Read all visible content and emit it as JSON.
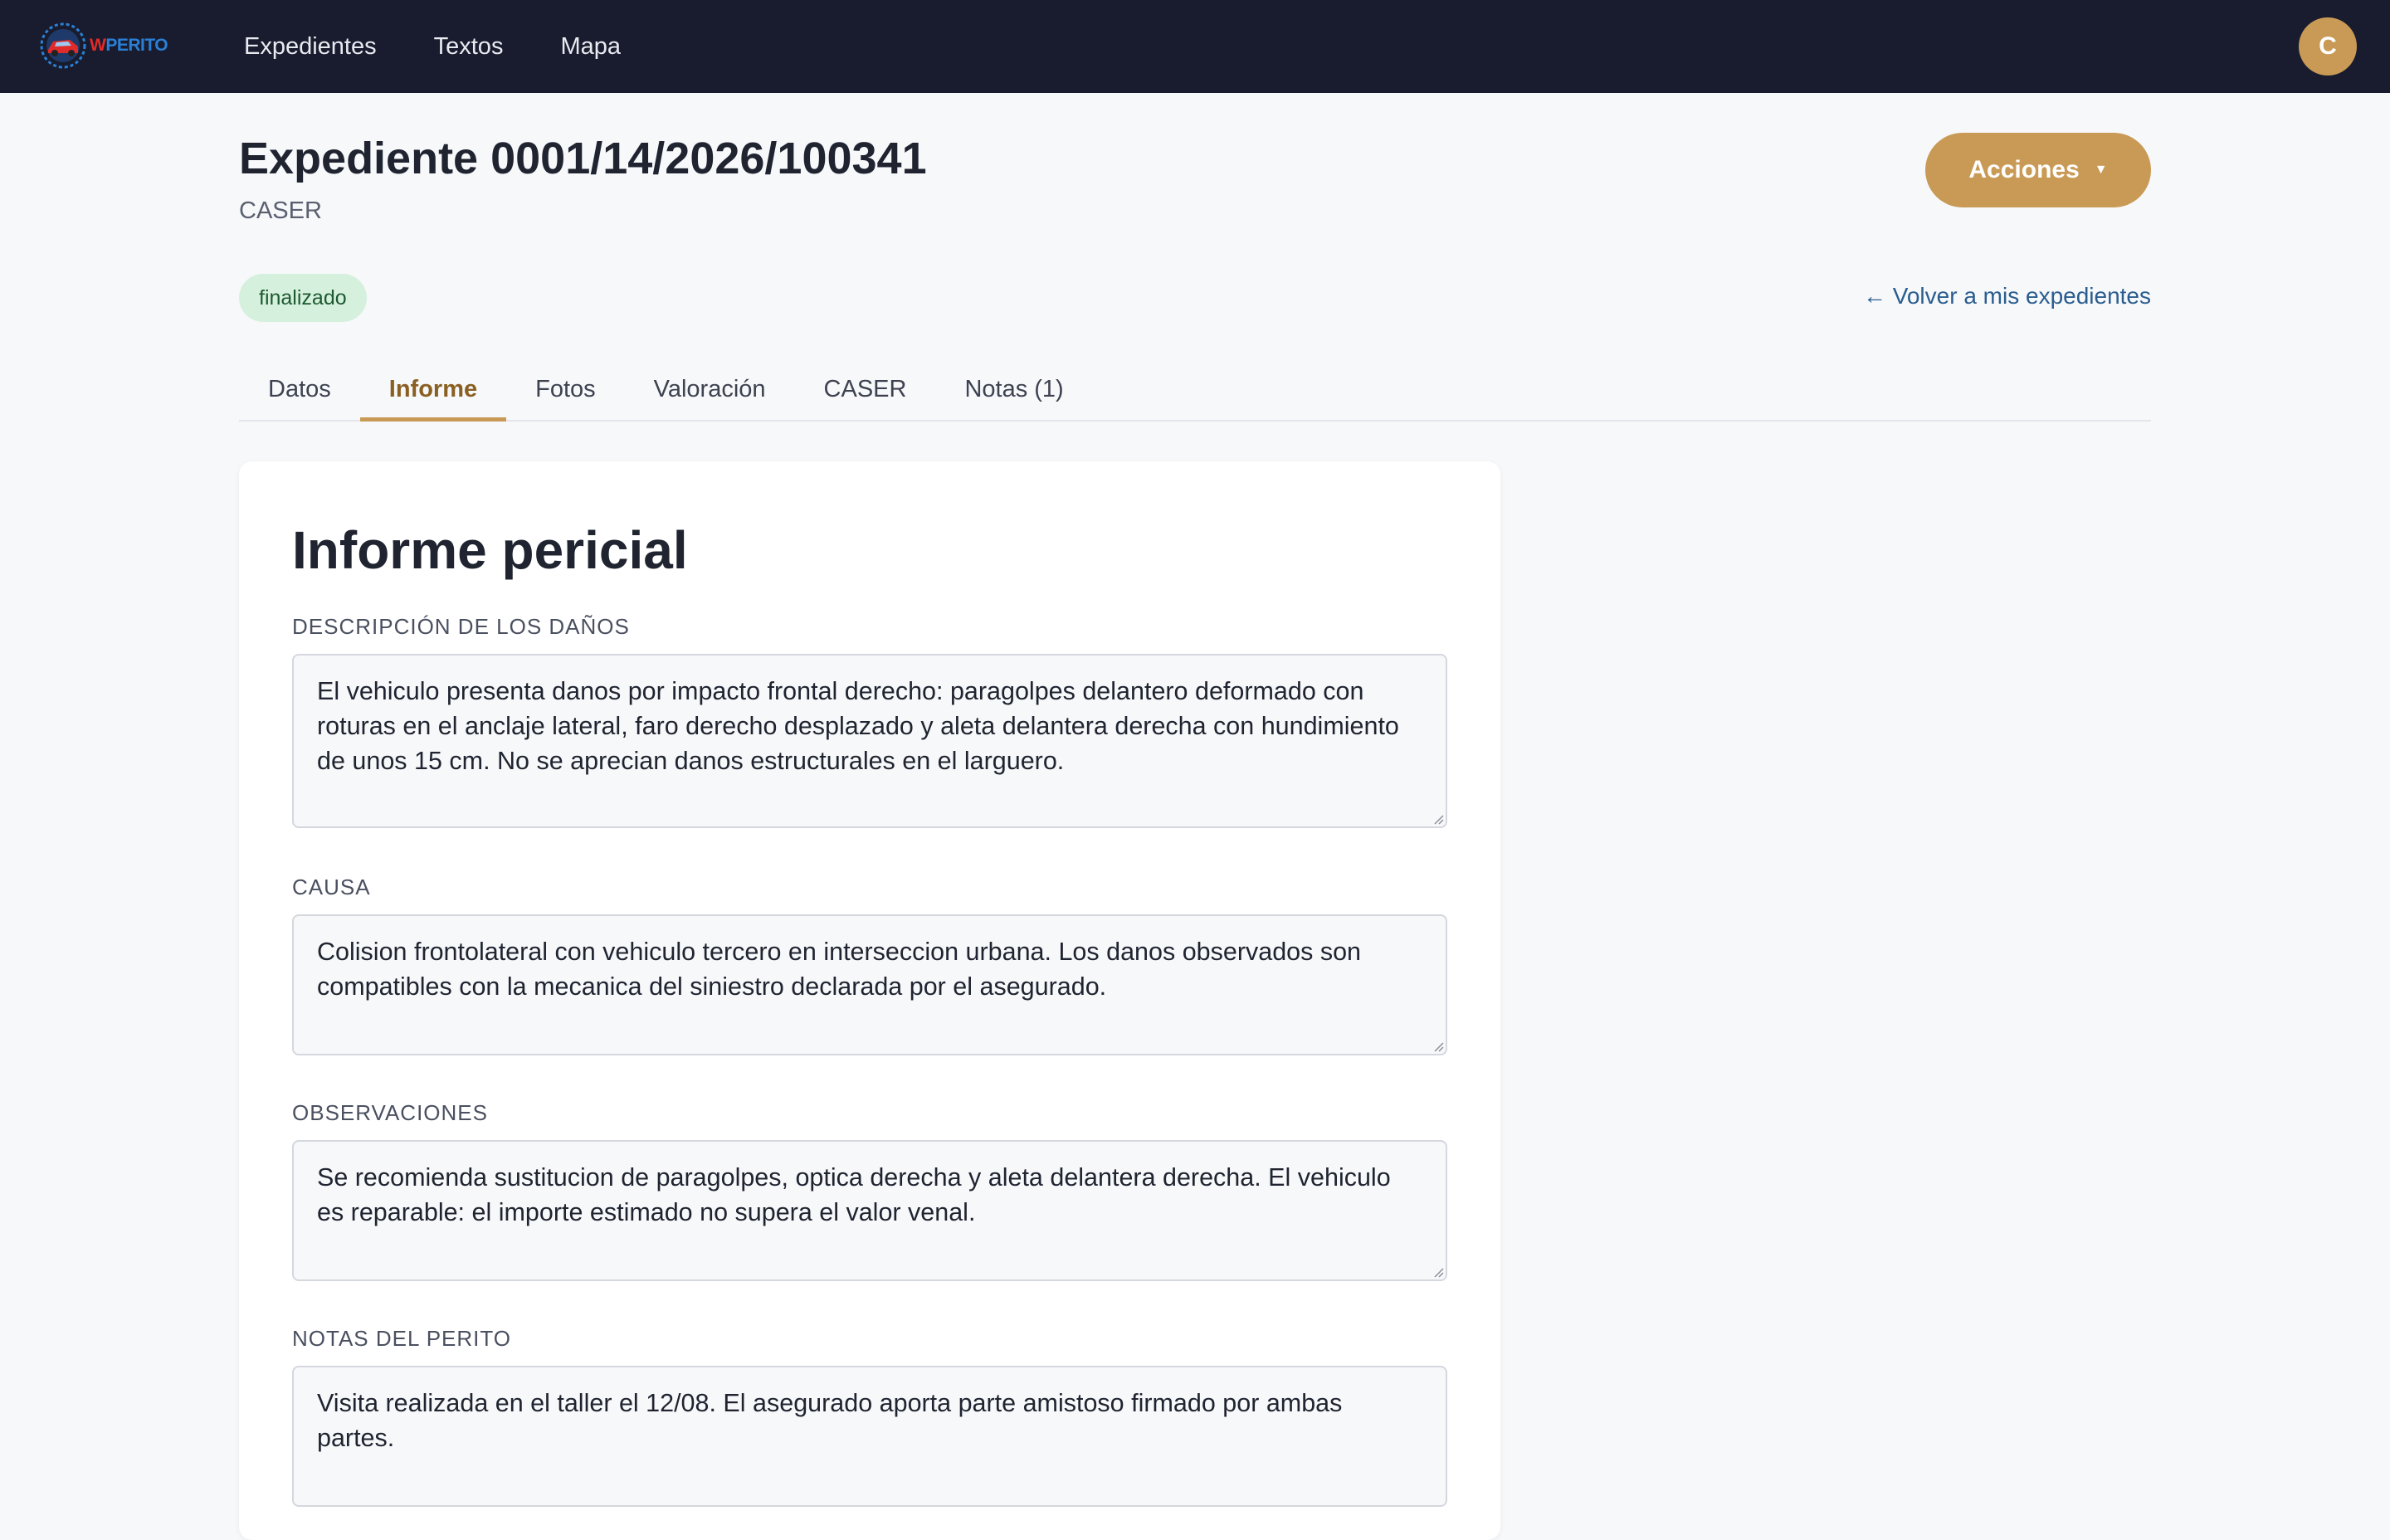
{
  "nav": {
    "logo_w": "W",
    "logo_rest": "PERITO",
    "links": [
      "Expedientes",
      "Textos",
      "Mapa"
    ],
    "avatar_initial": "C"
  },
  "header": {
    "title": "Expediente 0001/14/2026/100341",
    "subtitle": "CASER",
    "actions_label": "Acciones",
    "status": "finalizado",
    "back_link": "← Volver a mis expedientes"
  },
  "tabs": [
    {
      "label": "Datos",
      "active": false
    },
    {
      "label": "Informe",
      "active": true
    },
    {
      "label": "Fotos",
      "active": false
    },
    {
      "label": "Valoración",
      "active": false
    },
    {
      "label": "CASER",
      "active": false
    },
    {
      "label": "Notas (1)",
      "active": false
    }
  ],
  "report": {
    "title": "Informe pericial",
    "fields": [
      {
        "label": "DESCRIPCIÓN DE LOS DAÑOS",
        "value": "El vehiculo presenta danos por impacto frontal derecho: paragolpes delantero deformado con roturas en el anclaje lateral, faro derecho desplazado y aleta delantera derecha con hundimiento de unos 15 cm. No se aprecian danos estructurales en el larguero."
      },
      {
        "label": "CAUSA",
        "value": "Colision frontolateral con vehiculo tercero en interseccion urbana. Los danos observados son compatibles con la mecanica del siniestro declarada por el asegurado."
      },
      {
        "label": "OBSERVACIONES",
        "value": "Se recomienda sustitucion de paragolpes, optica derecha y aleta delantera derecha. El vehiculo es reparable: el importe estimado no supera el valor venal."
      },
      {
        "label": "NOTAS DEL PERITO",
        "value": "Visita realizada en el taller el 12/08. El asegurado aporta parte amistoso firmado por ambas partes."
      }
    ]
  },
  "colors": {
    "navbar": "#181c2e",
    "accent": "#c99a55",
    "badge_bg": "#d6f0de",
    "link": "#2a5d8f"
  }
}
